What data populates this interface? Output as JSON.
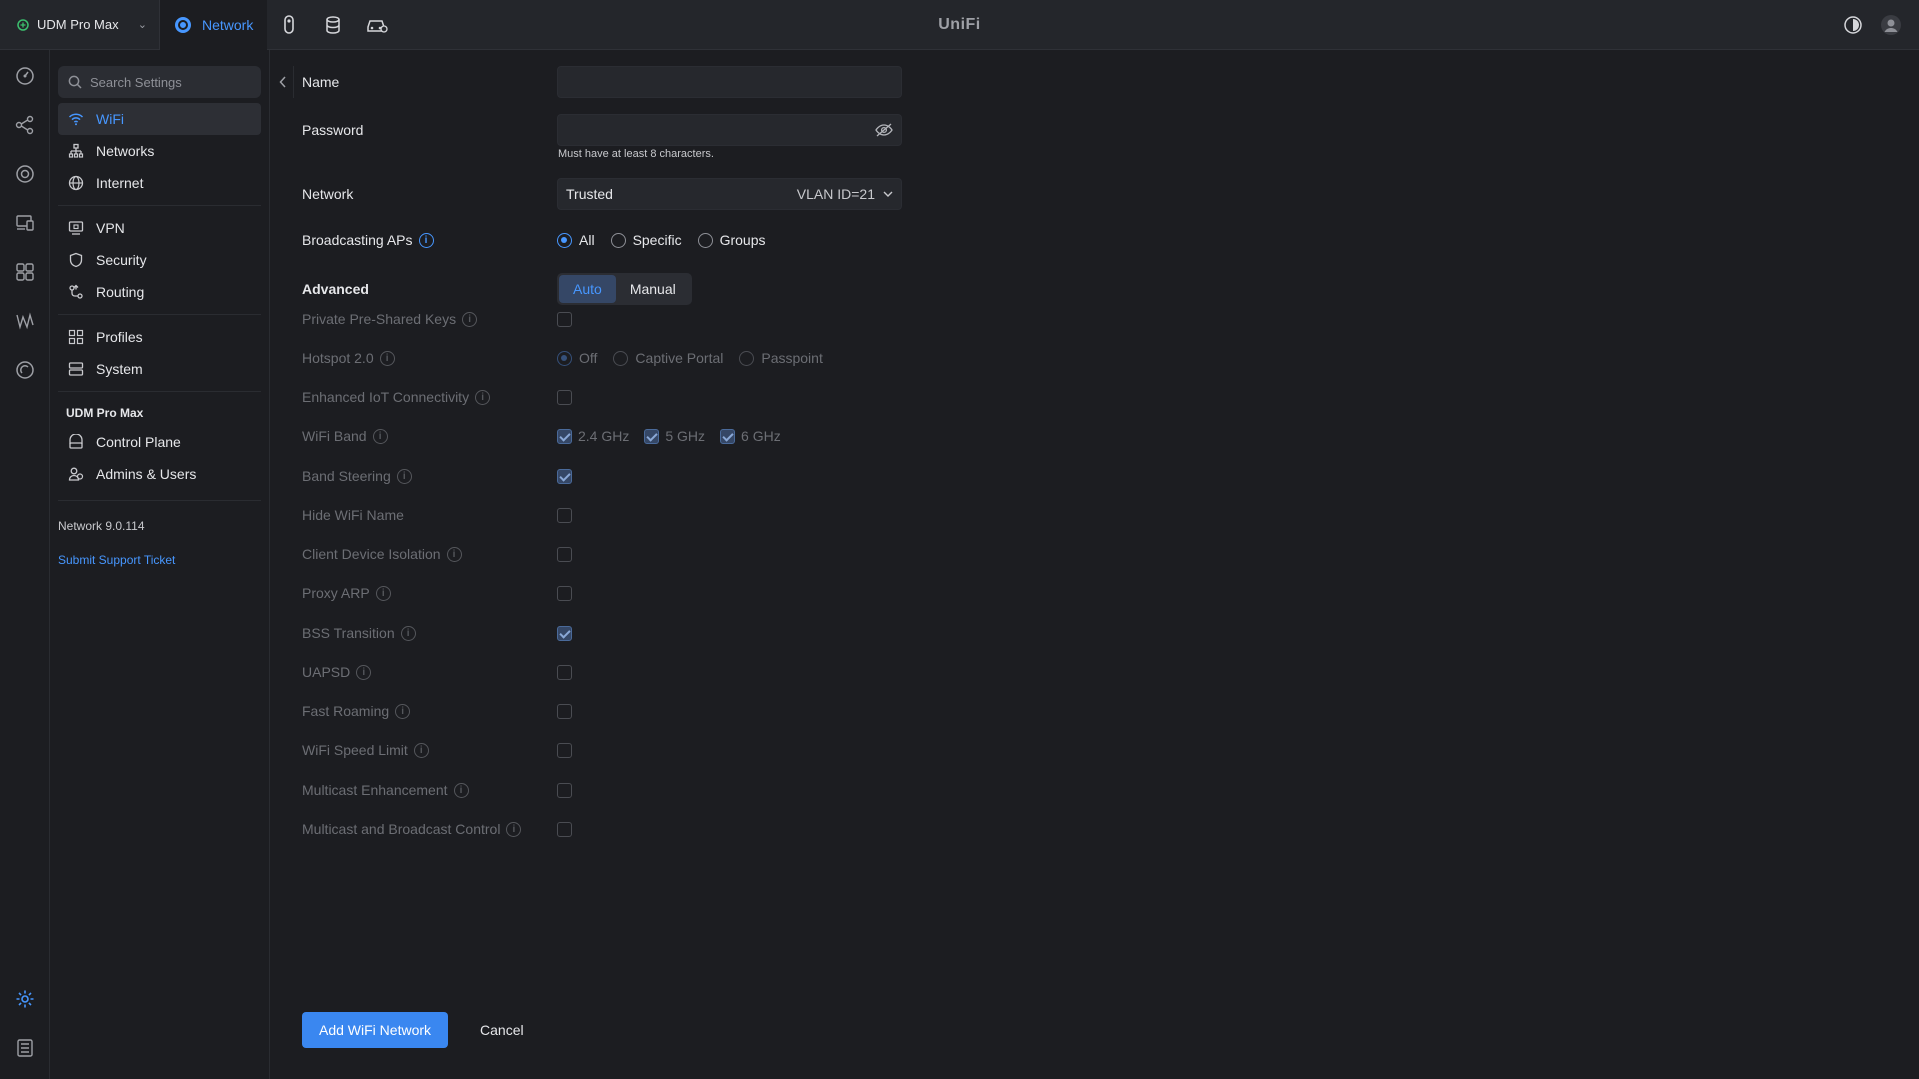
{
  "topbar": {
    "device_name": "UDM Pro Max",
    "app_tab_label": "Network",
    "brand": "UniFi",
    "app_icons": [
      "protect-camera-icon",
      "storage-icon",
      "access-vehicle-icon"
    ]
  },
  "rail": {
    "icons": [
      "dashboard-icon",
      "topology-icon",
      "devices-icon",
      "client-devices-icon",
      "insights-icon",
      "traffic-icon",
      "alerts-icon",
      "settings-icon",
      "logs-icon"
    ]
  },
  "sidebar": {
    "search_placeholder": "Search Settings",
    "groups": [
      [
        {
          "label": "WiFi",
          "icon": "wifi-icon",
          "active": true
        },
        {
          "label": "Networks",
          "icon": "networks-icon"
        },
        {
          "label": "Internet",
          "icon": "globe-icon"
        }
      ],
      [
        {
          "label": "VPN",
          "icon": "vpn-icon"
        },
        {
          "label": "Security",
          "icon": "shield-icon"
        },
        {
          "label": "Routing",
          "icon": "routing-icon"
        }
      ],
      [
        {
          "label": "Profiles",
          "icon": "profiles-icon"
        },
        {
          "label": "System",
          "icon": "system-icon"
        }
      ]
    ],
    "device_section_title": "UDM Pro Max",
    "device_items": [
      {
        "label": "Control Plane",
        "icon": "control-plane-icon"
      },
      {
        "label": "Admins & Users",
        "icon": "users-icon"
      }
    ],
    "version": "Network 9.0.114",
    "support_link": "Submit Support Ticket"
  },
  "form": {
    "name_label": "Name",
    "name_value": "",
    "password_label": "Password",
    "password_value": "",
    "password_hint": "Must have at least 8 characters.",
    "network_label": "Network",
    "network_value": "Trusted",
    "network_vlan": "VLAN ID=21",
    "broadcasting_label": "Broadcasting APs",
    "broadcasting_options": [
      "All",
      "Specific",
      "Groups"
    ],
    "broadcasting_selected": "All",
    "advanced_label": "Advanced",
    "advanced_options": [
      "Auto",
      "Manual"
    ],
    "advanced_selected": "Auto",
    "ppsk_label": "Private Pre-Shared Keys",
    "ppsk_checked": false,
    "hotspot_label": "Hotspot 2.0",
    "hotspot_options": [
      "Off",
      "Captive Portal",
      "Passpoint"
    ],
    "hotspot_selected": "Off",
    "iot_label": "Enhanced IoT Connectivity",
    "iot_checked": false,
    "band_label": "WiFi Band",
    "bands": [
      {
        "label": "2.4 GHz",
        "checked": true
      },
      {
        "label": "5 GHz",
        "checked": true
      },
      {
        "label": "6 GHz",
        "checked": true
      }
    ],
    "steering_label": "Band Steering",
    "steering_checked": true,
    "hide_name_label": "Hide WiFi Name",
    "hide_name_checked": false,
    "isolation_label": "Client Device Isolation",
    "isolation_checked": false,
    "proxy_arp_label": "Proxy ARP",
    "proxy_arp_checked": false,
    "bss_label": "BSS Transition",
    "bss_checked": true,
    "uapsd_label": "UAPSD",
    "uapsd_checked": false,
    "fast_roaming_label": "Fast Roaming",
    "fast_roaming_checked": false,
    "speed_limit_label": "WiFi Speed Limit",
    "speed_limit_checked": false,
    "multicast_enh_label": "Multicast Enhancement",
    "multicast_enh_checked": false,
    "multicast_ctrl_label": "Multicast and Broadcast Control",
    "multicast_ctrl_checked": false
  },
  "footer": {
    "submit_label": "Add WiFi Network",
    "cancel_label": "Cancel"
  },
  "colors": {
    "accent": "#4797ff",
    "background": "#1c1d21",
    "topbar": "#24262b"
  }
}
